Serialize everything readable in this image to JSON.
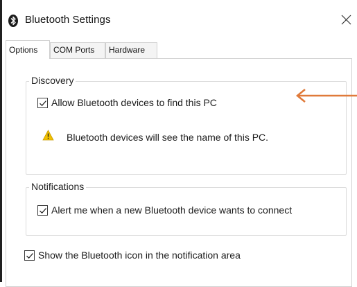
{
  "window": {
    "title": "Bluetooth Settings"
  },
  "tabs": [
    {
      "label": "Options",
      "active": true
    },
    {
      "label": "COM Ports",
      "active": false
    },
    {
      "label": "Hardware",
      "active": false
    }
  ],
  "discovery": {
    "legend": "Discovery",
    "allow_checkbox": {
      "label": "Allow Bluetooth devices to find this PC",
      "checked": true
    },
    "warning": "Bluetooth devices will see the name of this PC."
  },
  "notifications": {
    "legend": "Notifications",
    "alert_checkbox": {
      "label": "Alert me when a new Bluetooth device wants to connect",
      "checked": true
    }
  },
  "show_icon_checkbox": {
    "label": "Show the Bluetooth icon in the notification area",
    "checked": true
  },
  "colors": {
    "annotation_arrow": "#e07a3a",
    "bluetooth_badge": "#1b1b1b",
    "warning_yellow": "#f2c100"
  },
  "icons": {
    "title": "bluetooth-icon",
    "close": "close-icon",
    "warning": "warning-icon",
    "annotation": "arrow-left-icon"
  }
}
